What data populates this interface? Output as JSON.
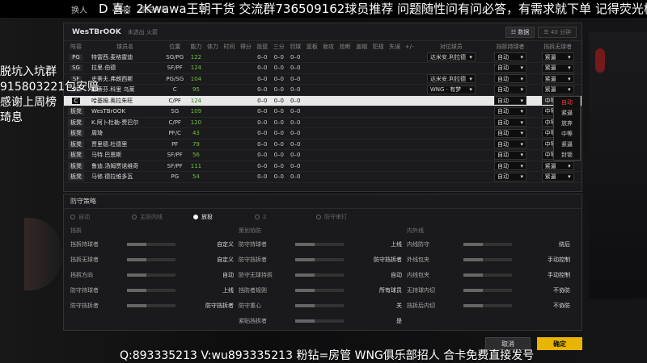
{
  "stream_bar": {
    "tab1": "换人",
    "tab2": "阵容",
    "tab3": "球员分配"
  },
  "danmaku": {
    "top": "D 喜：2Kwawa王朝干货 交流群736509162球员推荐 问题随性问有问必答，有需求就下单 记得荧光棒",
    "left": [
      "脱坑入坑群",
      "915803221包安赔",
      "感谢上周榜",
      "琦息"
    ],
    "bottom": "Q:893335213 V:wu893335213 粉钻=房管  WNG俱乐部招人 合卡免费直接发号"
  },
  "team": {
    "name": "WesTBrOOK",
    "subtitle": "未选出 火箭",
    "view_grid": "数据",
    "view_list": "40 分钟"
  },
  "columns": [
    "阵容",
    "球员名",
    "位置",
    "能力",
    "体力",
    "时间",
    "得分",
    "投篮",
    "三分",
    "罚球",
    "篮板",
    "助攻",
    "抢断",
    "盖帽",
    "犯规",
    "失误",
    "+/-",
    "对位球员",
    "挡拆持球者",
    "挡拆无球者"
  ],
  "players": [
    {
      "role": "PG",
      "name": "特雷西.麦格雷迪",
      "pos": "SG/PG",
      "ovr": "122",
      "stat": [
        "0–0",
        "0–0",
        "0–0"
      ],
      "matchup": "达米安.利拉德",
      "pnr_ball": "自动",
      "pnr_off": "紧逼"
    },
    {
      "role": "SG",
      "name": "拉里.伯德",
      "pos": "SF/PF",
      "ovr": "124",
      "stat": [
        "0–0",
        "0–0",
        "0–0"
      ],
      "matchup": "",
      "pnr_ball": "自动",
      "pnr_off": "紧逼"
    },
    {
      "role": "SF",
      "name": "史蒂夫.弗朗西斯",
      "pos": "PG/SG",
      "ovr": "104",
      "stat": [
        "0–0",
        "0–0",
        "0–0"
      ],
      "matchup": "达米安.利拉德",
      "pnr_ball": "自动",
      "pnr_off": "紧逼"
    },
    {
      "role": "PF",
      "name": "斯蒂芬.科里 乌莱",
      "pos": "C",
      "ovr": "95",
      "stat": [
        "0–0",
        "0–0",
        "0–0"
      ],
      "matchup": "WNG · 有梦",
      "pnr_ball": "自动",
      "pnr_off": "紧逼"
    },
    {
      "role": "C",
      "name": "哈基姆.奥拉朱旺",
      "pos": "C/PF",
      "ovr": "124",
      "stat": [
        "0–0",
        "0–0",
        "0–0"
      ],
      "matchup": "",
      "pnr_ball": "自动",
      "pnr_off": "中等"
    },
    {
      "role": "板凳",
      "name": "WesTBrOOK",
      "pos": "SG",
      "ovr": "109",
      "stat": [
        "0–0",
        "0–0",
        "0–0"
      ],
      "matchup": "",
      "pnr_ball": "自动",
      "pnr_off": "中等"
    },
    {
      "role": "板凳",
      "name": "K.阿卜杜勒-贾巴尔",
      "pos": "C/PF",
      "ovr": "120",
      "stat": [
        "0–0",
        "0–0",
        "0–0"
      ],
      "matchup": "",
      "pnr_ball": "自动",
      "pnr_off": "中等"
    },
    {
      "role": "板凳",
      "name": "周琦",
      "pos": "PF/C",
      "ovr": "43",
      "stat": [
        "0–0",
        "0–0",
        "0–0"
      ],
      "matchup": "",
      "pnr_ball": "自动",
      "pnr_off": "中等"
    },
    {
      "role": "板凳",
      "name": "贾里德.杜德里",
      "pos": "PF",
      "ovr": "79",
      "stat": [
        "0–0",
        "0–0",
        "0–0"
      ],
      "matchup": "",
      "pnr_ball": "自动",
      "pnr_off": "中等"
    },
    {
      "role": "板凳",
      "name": "马特.巴恩斯",
      "pos": "SF/PF",
      "ovr": "56",
      "stat": [
        "0–0",
        "0–0",
        "0–0"
      ],
      "matchup": "",
      "pnr_ball": "自动",
      "pnr_off": "中等"
    },
    {
      "role": "板凳",
      "name": "鲁迪.汤姆贾诺维奇",
      "pos": "SF/PF",
      "ovr": "111",
      "stat": [
        "0–0",
        "0–0",
        "0–0"
      ],
      "matchup": "",
      "pnr_ball": "自动",
      "pnr_off": "紧逼"
    },
    {
      "role": "板凳",
      "name": "马修.德拉维多瓦",
      "pos": "PG",
      "ovr": "54",
      "stat": [
        "0–0",
        "0–0",
        "0–0"
      ],
      "matchup": "",
      "pnr_ball": "自动",
      "pnr_off": "紧逼"
    }
  ],
  "dropdown_menu": [
    "自动",
    "紧逼",
    "放弃",
    "中等",
    "紧逼",
    "封锁"
  ],
  "strategy": {
    "title": "防守策略",
    "modes": [
      "自动",
      "主防内线",
      "放投",
      "2",
      "防守审打"
    ],
    "mode_selected": 2,
    "col1": {
      "title": "挡拆",
      "rows": [
        [
          "挡拆持球者",
          "自定义"
        ],
        [
          "挡拆无球者",
          "自定义"
        ],
        [
          "挡拆方向",
          "自动"
        ],
        [
          "防守持球者",
          "上线"
        ],
        [
          "防守挡拆者",
          "防守挡拆者"
        ]
      ],
      "sub": "中锋位移"
    },
    "col2": {
      "title": "策划协防",
      "rows": [
        [
          "防守持球者",
          "上线"
        ],
        [
          "防守挡拆者",
          "防守挡拆者"
        ],
        [
          "防守无球持拆",
          "自动"
        ],
        [
          "挡防者规则",
          "所有球员"
        ],
        [
          "防守重心",
          "关"
        ],
        [
          "紧贴挡拆者",
          "是"
        ]
      ]
    },
    "col3": {
      "title": "内外线",
      "rows": [
        [
          "内线防守",
          "绕后"
        ],
        [
          "外线包夹",
          "手动控制"
        ],
        [
          "内线包夹",
          "手动控制"
        ],
        [
          "无持球内切",
          "不协防"
        ],
        [
          "挡拆后内切",
          "不协防"
        ]
      ]
    }
  },
  "buttons": {
    "cancel": "取消",
    "ok": "确定"
  }
}
